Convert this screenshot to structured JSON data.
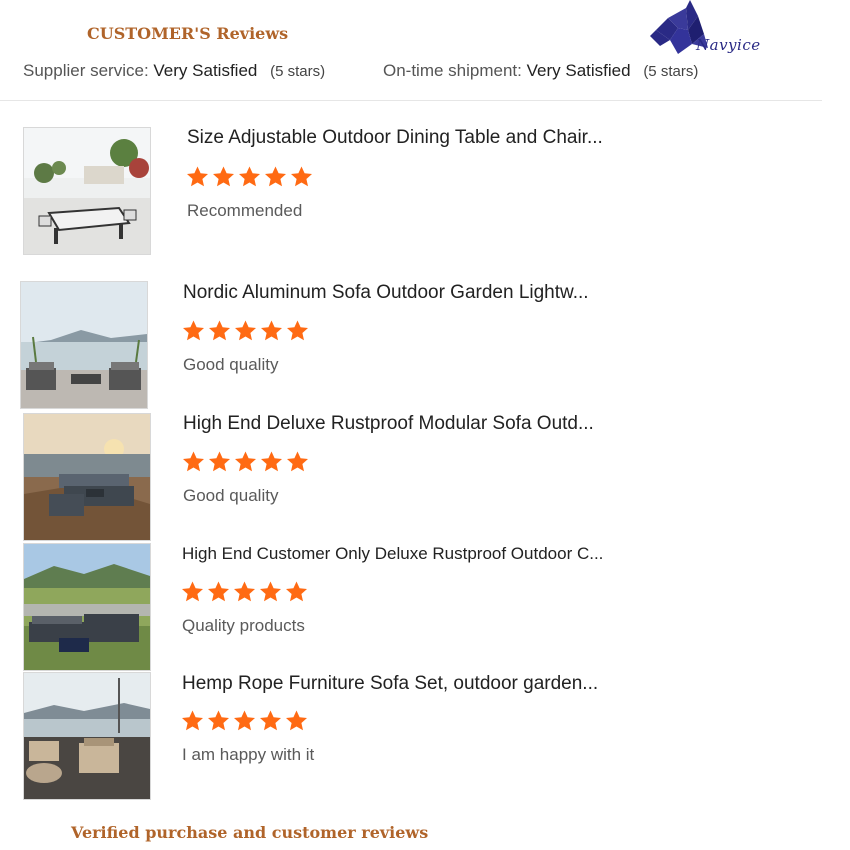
{
  "header": {
    "title": "CUSTOMER'S Reviews",
    "brand": "Navyice"
  },
  "ratings": {
    "supplier": {
      "label": "Supplier service:",
      "value": "Very Satisfied",
      "count": "(5 stars)"
    },
    "shipment": {
      "label": "On-time shipment:",
      "value": "Very Satisfied",
      "count": "(5 stars)"
    }
  },
  "colors": {
    "accent": "#b0642a",
    "star": "#ff6a13",
    "logo": "#2a2a85"
  },
  "reviews": [
    {
      "title": "Size Adjustable Outdoor Dining Table and Chair...",
      "stars": 5,
      "text": "Recommended",
      "image": "dining-set-photo"
    },
    {
      "title": "Nordic Aluminum Sofa Outdoor Garden Lightw...",
      "stars": 5,
      "text": "Good quality",
      "image": "lakeside-sofa-photo"
    },
    {
      "title": "High End Deluxe Rustproof Modular Sofa Outd...",
      "stars": 5,
      "text": "Good quality",
      "image": "beach-modular-sofa-photo"
    },
    {
      "title": "High End Customer Only Deluxe Rustproof Outdoor C...",
      "stars": 5,
      "text": "Quality products",
      "image": "field-sofa-photo"
    },
    {
      "title": "Hemp Rope Furniture Sofa Set, outdoor garden...",
      "stars": 5,
      "text": "I am happy with it",
      "image": "rope-sofa-photo"
    }
  ],
  "footer": {
    "text": "Verified purchase and customer reviews"
  }
}
